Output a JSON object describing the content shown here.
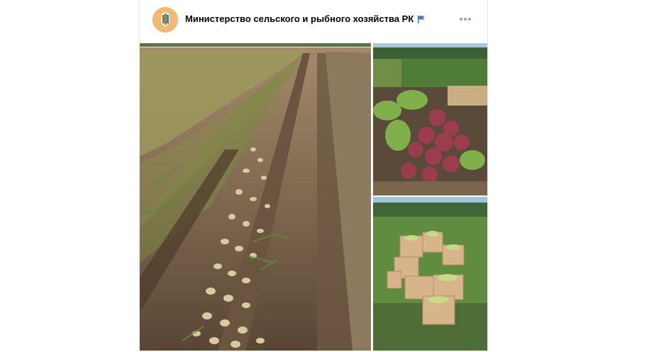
{
  "post": {
    "author_name": "Министерство сельского и рыбного хозяйства РК",
    "verified_icon": "flag-icon",
    "more_icon": "more-dots-icon",
    "avatar_icon": "ministry-logo-icon"
  },
  "photos": [
    {
      "name": "photo-potato-field",
      "subject": "potatoes in furrows"
    },
    {
      "name": "photo-beetroot-harvest",
      "subject": "beetroot pile"
    },
    {
      "name": "photo-zucchini-boxes",
      "subject": "zucchini crates"
    }
  ],
  "colors": {
    "accent": "#4a76a8",
    "avatar_bg": "#f3b973",
    "muted": "#99a2ad"
  }
}
